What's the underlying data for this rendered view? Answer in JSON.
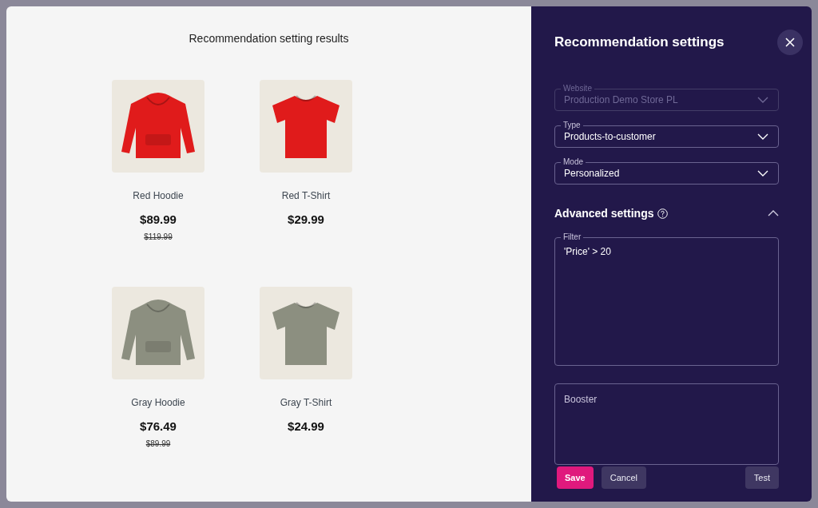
{
  "results": {
    "title": "Recommendation setting results",
    "products": [
      {
        "name": "Red Hoodie",
        "kind": "hoodie",
        "color": "#e01b1b",
        "price": "$89.99",
        "old_price": "$119.99"
      },
      {
        "name": "Red T-Shirt",
        "kind": "tshirt",
        "color": "#e01b1b",
        "price": "$29.99"
      },
      {
        "name": "Gray Hoodie",
        "kind": "hoodie",
        "color": "#8c8f80",
        "price": "$76.49",
        "old_price": "$89.99"
      },
      {
        "name": "Gray T-Shirt",
        "kind": "tshirt",
        "color": "#8c8f80",
        "price": "$24.99"
      }
    ]
  },
  "settings": {
    "title": "Recommendation settings",
    "fields": [
      {
        "label": "Website",
        "value": "Production Demo Store PL",
        "disabled": true
      },
      {
        "label": "Type",
        "value": "Products-to-customer",
        "disabled": false
      },
      {
        "label": "Mode",
        "value": "Personalized",
        "disabled": false
      }
    ],
    "advanced": {
      "title": "Advanced settings",
      "expanded": true,
      "filter": {
        "label": "Filter",
        "value": "'Price' > 20"
      },
      "booster": {
        "placeholder": "Booster"
      }
    },
    "buttons": [
      {
        "label": "Save",
        "kind": "primary"
      },
      {
        "label": "Cancel",
        "kind": "secondary"
      },
      {
        "label": "Test",
        "kind": "secondary"
      }
    ]
  }
}
